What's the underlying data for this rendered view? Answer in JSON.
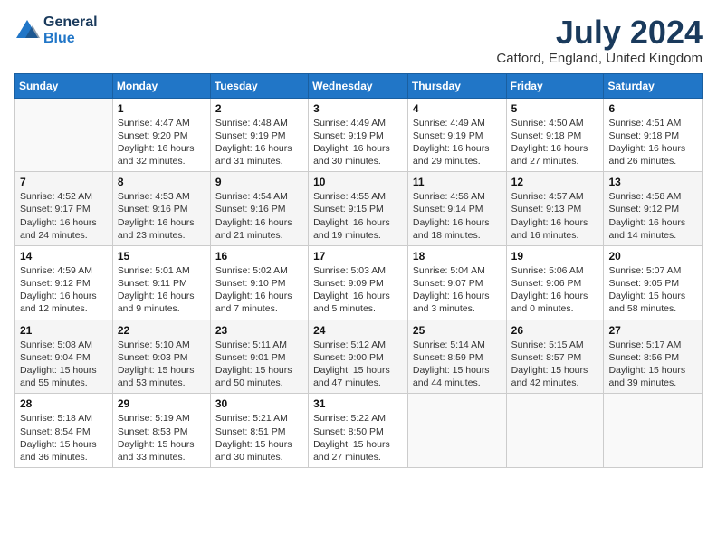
{
  "header": {
    "logo_line1": "General",
    "logo_line2": "Blue",
    "month_year": "July 2024",
    "location": "Catford, England, United Kingdom"
  },
  "days_of_week": [
    "Sunday",
    "Monday",
    "Tuesday",
    "Wednesday",
    "Thursday",
    "Friday",
    "Saturday"
  ],
  "weeks": [
    [
      {
        "day": "",
        "content": ""
      },
      {
        "day": "1",
        "content": "Sunrise: 4:47 AM\nSunset: 9:20 PM\nDaylight: 16 hours\nand 32 minutes."
      },
      {
        "day": "2",
        "content": "Sunrise: 4:48 AM\nSunset: 9:19 PM\nDaylight: 16 hours\nand 31 minutes."
      },
      {
        "day": "3",
        "content": "Sunrise: 4:49 AM\nSunset: 9:19 PM\nDaylight: 16 hours\nand 30 minutes."
      },
      {
        "day": "4",
        "content": "Sunrise: 4:49 AM\nSunset: 9:19 PM\nDaylight: 16 hours\nand 29 minutes."
      },
      {
        "day": "5",
        "content": "Sunrise: 4:50 AM\nSunset: 9:18 PM\nDaylight: 16 hours\nand 27 minutes."
      },
      {
        "day": "6",
        "content": "Sunrise: 4:51 AM\nSunset: 9:18 PM\nDaylight: 16 hours\nand 26 minutes."
      }
    ],
    [
      {
        "day": "7",
        "content": "Sunrise: 4:52 AM\nSunset: 9:17 PM\nDaylight: 16 hours\nand 24 minutes."
      },
      {
        "day": "8",
        "content": "Sunrise: 4:53 AM\nSunset: 9:16 PM\nDaylight: 16 hours\nand 23 minutes."
      },
      {
        "day": "9",
        "content": "Sunrise: 4:54 AM\nSunset: 9:16 PM\nDaylight: 16 hours\nand 21 minutes."
      },
      {
        "day": "10",
        "content": "Sunrise: 4:55 AM\nSunset: 9:15 PM\nDaylight: 16 hours\nand 19 minutes."
      },
      {
        "day": "11",
        "content": "Sunrise: 4:56 AM\nSunset: 9:14 PM\nDaylight: 16 hours\nand 18 minutes."
      },
      {
        "day": "12",
        "content": "Sunrise: 4:57 AM\nSunset: 9:13 PM\nDaylight: 16 hours\nand 16 minutes."
      },
      {
        "day": "13",
        "content": "Sunrise: 4:58 AM\nSunset: 9:12 PM\nDaylight: 16 hours\nand 14 minutes."
      }
    ],
    [
      {
        "day": "14",
        "content": "Sunrise: 4:59 AM\nSunset: 9:12 PM\nDaylight: 16 hours\nand 12 minutes."
      },
      {
        "day": "15",
        "content": "Sunrise: 5:01 AM\nSunset: 9:11 PM\nDaylight: 16 hours\nand 9 minutes."
      },
      {
        "day": "16",
        "content": "Sunrise: 5:02 AM\nSunset: 9:10 PM\nDaylight: 16 hours\nand 7 minutes."
      },
      {
        "day": "17",
        "content": "Sunrise: 5:03 AM\nSunset: 9:09 PM\nDaylight: 16 hours\nand 5 minutes."
      },
      {
        "day": "18",
        "content": "Sunrise: 5:04 AM\nSunset: 9:07 PM\nDaylight: 16 hours\nand 3 minutes."
      },
      {
        "day": "19",
        "content": "Sunrise: 5:06 AM\nSunset: 9:06 PM\nDaylight: 16 hours\nand 0 minutes."
      },
      {
        "day": "20",
        "content": "Sunrise: 5:07 AM\nSunset: 9:05 PM\nDaylight: 15 hours\nand 58 minutes."
      }
    ],
    [
      {
        "day": "21",
        "content": "Sunrise: 5:08 AM\nSunset: 9:04 PM\nDaylight: 15 hours\nand 55 minutes."
      },
      {
        "day": "22",
        "content": "Sunrise: 5:10 AM\nSunset: 9:03 PM\nDaylight: 15 hours\nand 53 minutes."
      },
      {
        "day": "23",
        "content": "Sunrise: 5:11 AM\nSunset: 9:01 PM\nDaylight: 15 hours\nand 50 minutes."
      },
      {
        "day": "24",
        "content": "Sunrise: 5:12 AM\nSunset: 9:00 PM\nDaylight: 15 hours\nand 47 minutes."
      },
      {
        "day": "25",
        "content": "Sunrise: 5:14 AM\nSunset: 8:59 PM\nDaylight: 15 hours\nand 44 minutes."
      },
      {
        "day": "26",
        "content": "Sunrise: 5:15 AM\nSunset: 8:57 PM\nDaylight: 15 hours\nand 42 minutes."
      },
      {
        "day": "27",
        "content": "Sunrise: 5:17 AM\nSunset: 8:56 PM\nDaylight: 15 hours\nand 39 minutes."
      }
    ],
    [
      {
        "day": "28",
        "content": "Sunrise: 5:18 AM\nSunset: 8:54 PM\nDaylight: 15 hours\nand 36 minutes."
      },
      {
        "day": "29",
        "content": "Sunrise: 5:19 AM\nSunset: 8:53 PM\nDaylight: 15 hours\nand 33 minutes."
      },
      {
        "day": "30",
        "content": "Sunrise: 5:21 AM\nSunset: 8:51 PM\nDaylight: 15 hours\nand 30 minutes."
      },
      {
        "day": "31",
        "content": "Sunrise: 5:22 AM\nSunset: 8:50 PM\nDaylight: 15 hours\nand 27 minutes."
      },
      {
        "day": "",
        "content": ""
      },
      {
        "day": "",
        "content": ""
      },
      {
        "day": "",
        "content": ""
      }
    ]
  ]
}
